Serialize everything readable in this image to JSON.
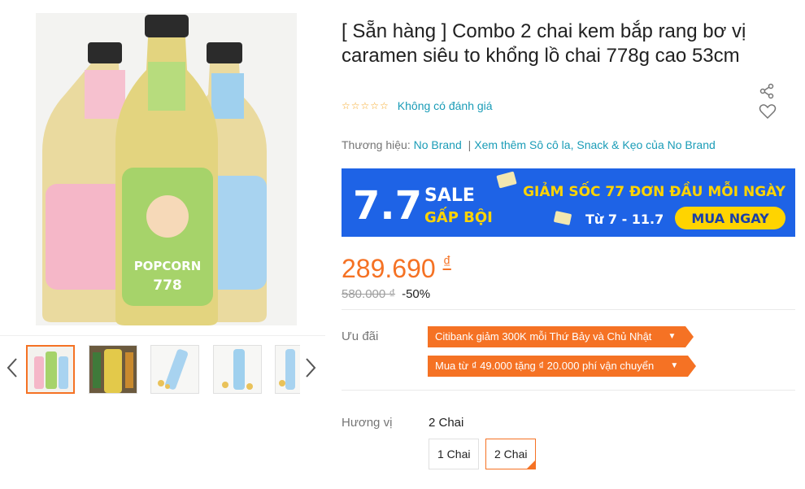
{
  "product": {
    "title": "[ Sẵn hàng ] Combo 2 chai kem bắp rang bơ vị caramen siêu to khổng lồ chai 778g cao 53cm",
    "rating_text": "Không có đánh giá",
    "brand_label": "Thương hiệu:",
    "brand_name": "No Brand",
    "brand_more": "Xem thêm Sô cô la, Snack & Kẹo của No Brand",
    "price": "289.690",
    "currency": "₫",
    "old_price": "580.000 ₫",
    "discount": "-50%"
  },
  "banner": {
    "big": "7.7",
    "sale": "SALE",
    "gap_boi": "GẤP BỘI",
    "headline": "GIẢM SỐC 77 ĐƠN ĐẦU MỖI NGÀY",
    "dates": "Từ 7 - 11.7",
    "cta": "MUA NGAY"
  },
  "image_labels": {
    "popcorn": "POPCORN",
    "size": "778"
  },
  "promotions": {
    "label": "Ưu đãi",
    "items": [
      "Citibank giảm 300K mỗi Thứ Bảy và Chủ Nhật",
      "Mua từ ₫ 49.000 tặng ₫ 20.000 phí vận chuyển"
    ]
  },
  "variant": {
    "label": "Hương vị",
    "selected": "2 Chai",
    "options": [
      "1 Chai",
      "2 Chai"
    ]
  },
  "colors": {
    "accent": "#f57224",
    "link": "#1a9cb7",
    "banner_bg": "#1e63e6",
    "banner_cta": "#ffd400"
  }
}
